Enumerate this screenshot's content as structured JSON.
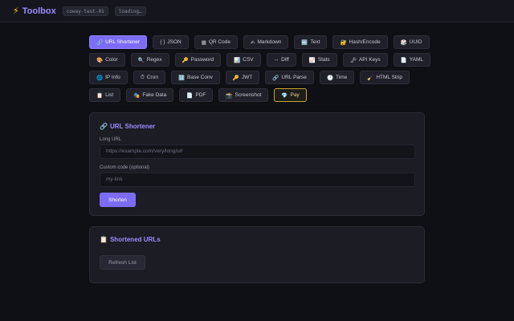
{
  "header": {
    "brand_icon": "⚡",
    "brand": "Toolbox",
    "host_tag": "coway-test-01",
    "status_tag": "loading…"
  },
  "tools": {
    "rows": [
      [
        {
          "icon": "🔗",
          "label": "URL Shortener",
          "active": true
        },
        {
          "icon": "{ }",
          "label": "JSON"
        },
        {
          "icon": "▦",
          "label": "QR Code"
        },
        {
          "icon": "✍",
          "label": "Markdown"
        },
        {
          "icon": "🔤",
          "label": "Text"
        },
        {
          "icon": "🔐",
          "label": "Hash/Encode"
        },
        {
          "icon": "🎲",
          "label": "UUID"
        }
      ],
      [
        {
          "icon": "🎨",
          "label": "Color"
        },
        {
          "icon": "🔍",
          "label": "Regex"
        },
        {
          "icon": "🔑",
          "label": "Password"
        },
        {
          "icon": "📊",
          "label": "CSV"
        },
        {
          "icon": "↔",
          "label": "Diff"
        },
        {
          "icon": "📈",
          "label": "Stats"
        },
        {
          "icon": "🗝",
          "label": "API Keys"
        },
        {
          "icon": "📄",
          "label": "YAML"
        }
      ],
      [
        {
          "icon": "🌐",
          "label": "IP Info"
        },
        {
          "icon": "⏱",
          "label": "Cron"
        },
        {
          "icon": "🔢",
          "label": "Base Conv"
        },
        {
          "icon": "🔑",
          "label": "JWT"
        },
        {
          "icon": "🔗",
          "label": "URL Parse"
        },
        {
          "icon": "🕐",
          "label": "Time"
        },
        {
          "icon": "🧹",
          "label": "HTML Strip"
        }
      ],
      [
        {
          "icon": "📋",
          "label": "List"
        },
        {
          "icon": "🎭",
          "label": "Fake Data"
        },
        {
          "icon": "📄",
          "label": "PDF"
        },
        {
          "icon": "📸",
          "label": "Screenshot"
        },
        {
          "icon": "💎",
          "label": "Pay",
          "highlight": true
        }
      ]
    ]
  },
  "shortener": {
    "icon": "🔗",
    "title": "URL Shortener",
    "long_url_label": "Long URL",
    "long_url_placeholder": "https://example.com/very/long/url",
    "long_url_value": "",
    "custom_code_label": "Custom code (optional)",
    "custom_code_placeholder": "my-link",
    "custom_code_value": "",
    "submit_label": "Shorten"
  },
  "shortened": {
    "icon": "📋",
    "title": "Shortened URLs",
    "refresh_label": "Refresh List"
  },
  "colors": {
    "accent": "#7c6cf5",
    "brand": "#9b8cff",
    "pay_border": "#c9a531",
    "background": "#0f1015",
    "card": "#1b1c24"
  }
}
